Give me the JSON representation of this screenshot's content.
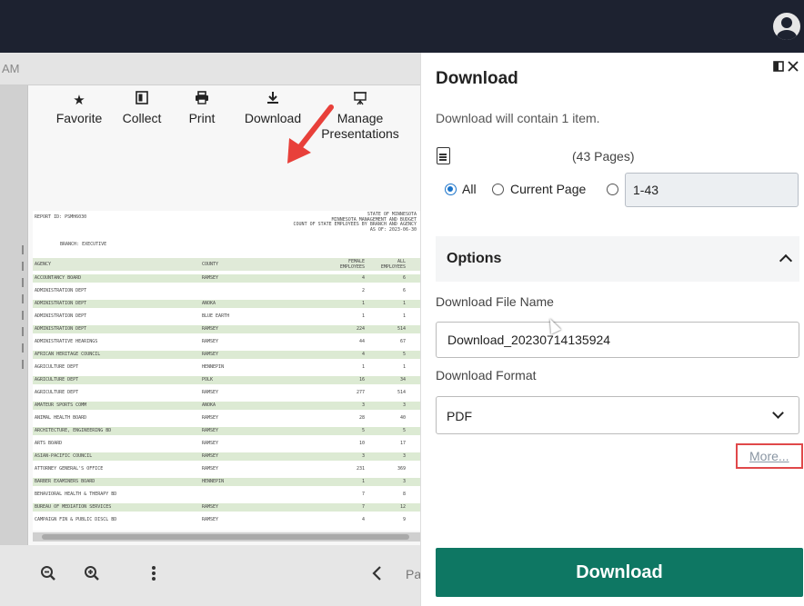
{
  "breadcrumb_fragment": "AM",
  "toolbar": {
    "items": [
      {
        "label": "Favorite",
        "icon": "star-icon"
      },
      {
        "label": "Collect",
        "icon": "collect-icon"
      },
      {
        "label": "Print",
        "icon": "print-icon"
      },
      {
        "label": "Download",
        "icon": "download-icon"
      },
      {
        "label_line1": "Manage",
        "label_line2": "Presentations",
        "icon": "presentation-icon"
      }
    ]
  },
  "report": {
    "report_id": "REPORT ID: PSMH6030",
    "header_lines": [
      "STATE OF MINNESOTA",
      "MINNESOTA MANAGEMENT AND BUDGET",
      "COUNT OF STATE EMPLOYEES BY BRANCH AND AGENCY",
      "AS OF: 2023-06-30"
    ],
    "branch": "BRANCH: EXECUTIVE",
    "columns": [
      "AGENCY",
      "COUNTY",
      "FEMALE EMPLOYEES",
      "ALL EMPLOYEES"
    ],
    "rows": [
      [
        "ACCOUNTANCY BOARD",
        "RAMSEY",
        "4",
        "6"
      ],
      [
        "ADMINISTRATION DEPT",
        "",
        "2",
        "6"
      ],
      [
        "ADMINISTRATION DEPT",
        "ANOKA",
        "1",
        "1"
      ],
      [
        "ADMINISTRATION DEPT",
        "BLUE EARTH",
        "1",
        "1"
      ],
      [
        "ADMINISTRATION DEPT",
        "RAMSEY",
        "224",
        "514"
      ],
      [
        "ADMINISTRATIVE HEARINGS",
        "RAMSEY",
        "44",
        "67"
      ],
      [
        "AFRICAN HERITAGE COUNCIL",
        "RAMSEY",
        "4",
        "5"
      ],
      [
        "AGRICULTURE DEPT",
        "HENNEPIN",
        "1",
        "1"
      ],
      [
        "AGRICULTURE DEPT",
        "POLK",
        "16",
        "34"
      ],
      [
        "AGRICULTURE DEPT",
        "RAMSEY",
        "277",
        "514"
      ],
      [
        "AMATEUR SPORTS COMM",
        "ANOKA",
        "3",
        "3"
      ],
      [
        "ANIMAL HEALTH BOARD",
        "RAMSEY",
        "28",
        "40"
      ],
      [
        "ARCHITECTURE, ENGINEERING BD",
        "RAMSEY",
        "5",
        "5"
      ],
      [
        "ARTS BOARD",
        "RAMSEY",
        "10",
        "17"
      ],
      [
        "ASIAN-PACIFIC COUNCIL",
        "RAMSEY",
        "3",
        "3"
      ],
      [
        "ATTORNEY GENERAL'S OFFICE",
        "RAMSEY",
        "231",
        "369"
      ],
      [
        "BARBER EXAMINERS BOARD",
        "HENNEPIN",
        "1",
        "3"
      ],
      [
        "BEHAVIORAL HEALTH & THERAPY BD",
        "",
        "7",
        "8"
      ],
      [
        "BUREAU OF MEDIATION SERVICES",
        "RAMSEY",
        "7",
        "12"
      ],
      [
        "CAMPAIGN FIN & PUBLIC DISCL BD",
        "RAMSEY",
        "4",
        "9"
      ]
    ]
  },
  "bottombar": {
    "zoom_out": "zoom-out-icon",
    "zoom_in": "zoom-in-icon",
    "more": "more-vertical-icon",
    "prev": "chevron-left-icon",
    "page_fragment": "Pa"
  },
  "panel": {
    "title": "Download",
    "description": "Download will contain 1 item.",
    "pages": "(43 Pages)",
    "radio_all": "All",
    "radio_current": "Current Page",
    "range_value": "1-43",
    "options_title": "Options",
    "file_name_label": "Download File Name",
    "file_name_value": "Download_20230714135924",
    "format_label": "Download Format",
    "format_value": "PDF",
    "more_link": "More...",
    "download_button": "Download"
  },
  "colors": {
    "topbar": "#1d2230",
    "primary_button": "#0e7763",
    "radio_selected": "#1a73c9",
    "highlight_box": "#e0484a",
    "arrow": "#e8403a"
  }
}
